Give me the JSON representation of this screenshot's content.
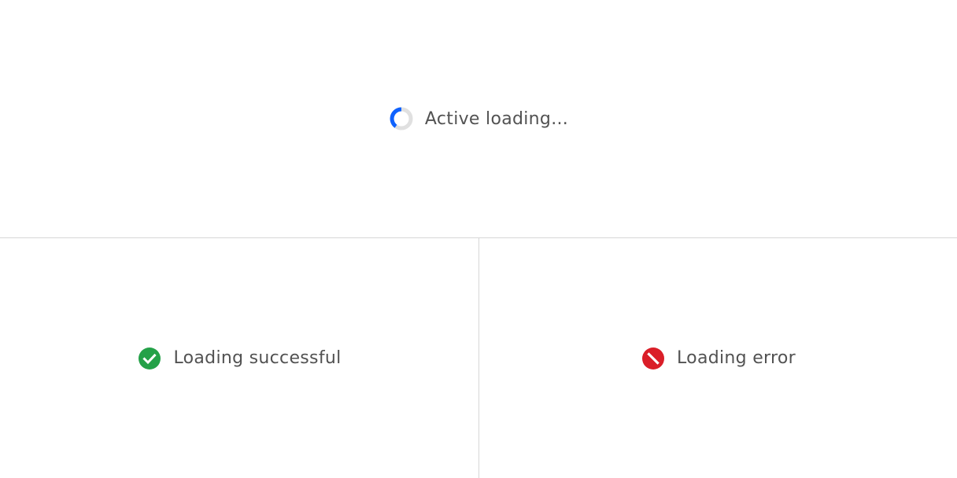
{
  "states": {
    "active": {
      "label": "Active loading...",
      "icon": "spinner-icon",
      "color": "#0f62fe",
      "track_color": "#e0e0e0"
    },
    "success": {
      "label": "Loading successful",
      "icon": "checkmark-filled-icon",
      "color": "#24a148"
    },
    "error": {
      "label": "Loading error",
      "icon": "error-filled-icon",
      "color": "#da1e28"
    }
  }
}
